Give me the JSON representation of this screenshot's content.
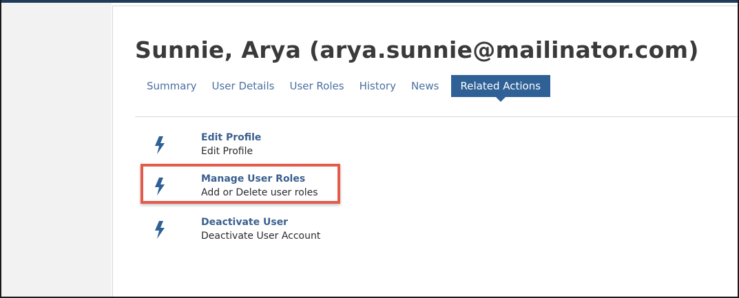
{
  "user": {
    "title": "Sunnie, Arya (arya.sunnie@mailinator.com)"
  },
  "tabs": [
    {
      "label": "Summary"
    },
    {
      "label": "User Details"
    },
    {
      "label": "User Roles"
    },
    {
      "label": "History"
    },
    {
      "label": "News"
    },
    {
      "label": "Related Actions",
      "active": true
    }
  ],
  "actions": [
    {
      "title": "Edit Profile",
      "description": "Edit Profile",
      "icon": "lightning-bolt-icon"
    },
    {
      "title": "Manage User Roles",
      "description": "Add or Delete user roles",
      "icon": "lightning-bolt-icon",
      "highlighted": true
    },
    {
      "title": "Deactivate User",
      "description": "Deactivate User Account",
      "icon": "lightning-bolt-icon"
    }
  ],
  "colors": {
    "accent": "#2f6196",
    "link": "#3a5f8f",
    "highlight": "#e45a4b",
    "topbar": "#1f3b5a"
  }
}
